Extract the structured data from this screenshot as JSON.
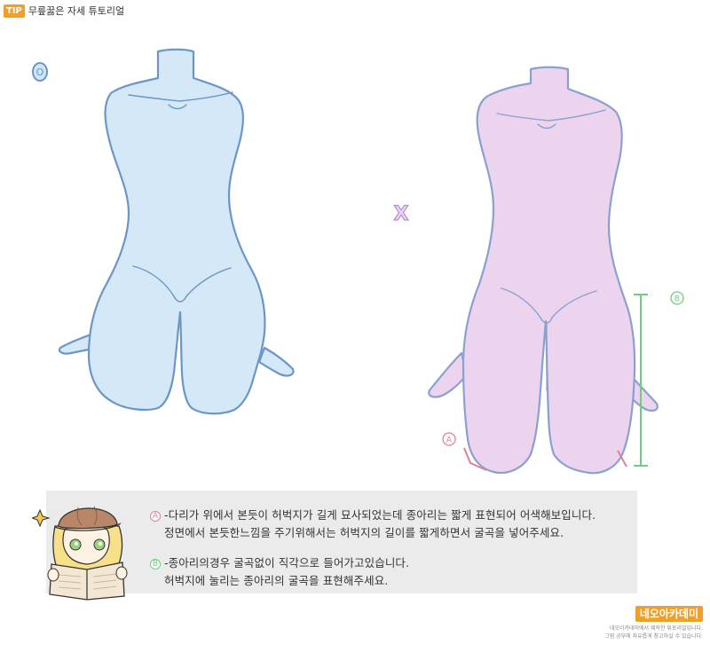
{
  "header": {
    "badge": "TIP",
    "title": "무릎꿇은 자세 튜토리얼"
  },
  "markers": {
    "good": "O",
    "bad": "X",
    "a": "A",
    "b": "B"
  },
  "colors": {
    "good_fill": "#d4e8f7",
    "good_stroke": "#6b96c6",
    "bad_fill": "#ecd4ef",
    "bad_stroke": "#b48ecf",
    "accent_orange": "#f0a02a",
    "marker_a": "#e07f9a",
    "marker_b": "#6ccf7e"
  },
  "notes": {
    "a_line1": "-다리가 위에서 본듯이 허벅지가 길게 묘사되었는데 종아리는 짧게 표현되어 어색해보입니다.",
    "a_line2": "정면에서 본듯한느낌을 주기위해서는 허벅지의 길이를  짧게하면서 굴곡을 넣어주세요.",
    "b_line1": "-종아리의경우 굴곡없이 직각으로 들어가고있습니다.",
    "b_line2": "허벅지에 눌리는 종아리의 굴곡을 표현해주세요."
  },
  "branding": {
    "logo": "네오아카데미",
    "line1": "네오아카데미에서 제작한 튜토리얼입니다.",
    "line2": "그림 공부에 자유롭게 참고하실 수 있습니다."
  }
}
